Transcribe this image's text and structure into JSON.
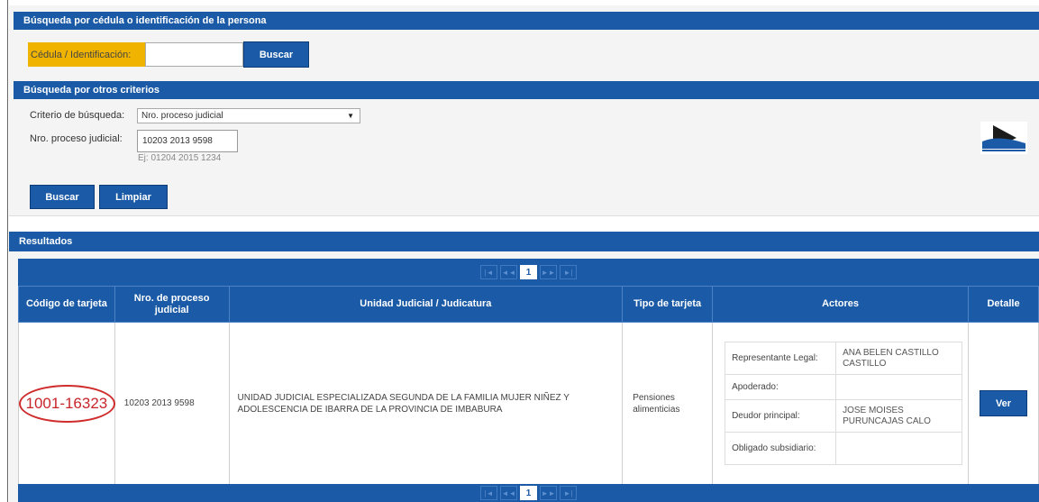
{
  "search_by_id": {
    "header": "Búsqueda por cédula o identificación de la persona",
    "label": "Cédula / Identificación:",
    "value": "",
    "button": "Buscar"
  },
  "search_other": {
    "header": "Búsqueda por otros criterios",
    "criterion_label": "Criterio de búsqueda:",
    "criterion_value": "Nro. proceso judicial",
    "process_label": "Nro. proceso judicial:",
    "process_value": "10203 2013 9598",
    "process_hint": "Ej: 01204 2015 1234",
    "search_button": "Buscar",
    "clear_button": "Limpiar"
  },
  "results": {
    "header": "Resultados",
    "pager": {
      "first": "|◄",
      "prev": "◄◄",
      "current": "1",
      "next": "►►",
      "last": "►|"
    },
    "columns": [
      "Código de tarjeta",
      "Nro. de proceso judicial",
      "Unidad Judicial / Judicatura",
      "Tipo de tarjeta",
      "Actores",
      "Detalle"
    ],
    "row": {
      "card_code": "1001-16323",
      "process_number": "10203 2013 9598",
      "judicial_unit": "UNIDAD JUDICIAL ESPECIALIZADA SEGUNDA DE LA FAMILIA MUJER NIÑEZ Y ADOLESCENCIA DE IBARRA DE LA PROVINCIA DE IMBABURA",
      "card_type": "Pensiones alimenticias",
      "actors": [
        {
          "role": "Representante Legal:",
          "name": "ANA BELEN CASTILLO CASTILLO"
        },
        {
          "role": "Apoderado:",
          "name": ""
        },
        {
          "role": "Deudor principal:",
          "name": "JOSE MOISES PURUNCAJAS CALO"
        },
        {
          "role": "Obligado subsidiario:",
          "name": ""
        }
      ],
      "detail_button": "Ver"
    }
  },
  "colors": {
    "brand_blue": "#1a5aa6",
    "label_yellow": "#f0b400",
    "annotation_red": "#d02c2c"
  }
}
